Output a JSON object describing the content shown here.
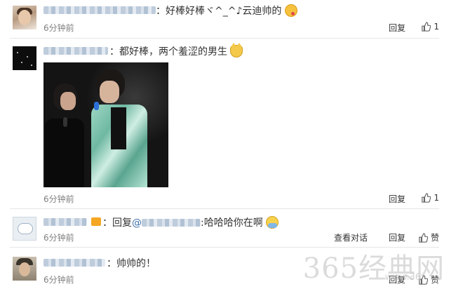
{
  "comments": [
    {
      "text_a": "：好棒好棒ヾ^_^♪云迪帅的",
      "emoji": "kiss-emoji",
      "time": "6分钟前",
      "reply": "回复",
      "likes": "1"
    },
    {
      "text_a": "：都好棒，两个羞涩的男生",
      "emoji": "cat-emoji",
      "time": "6分钟前",
      "reply": "回复",
      "likes": "1"
    },
    {
      "text_a": "：回复",
      "mention": "@",
      "text_b": ":哈哈哈你在啊",
      "emoji": "hand-emoji",
      "time": "6分钟前",
      "view_thread": "查看对话",
      "reply": "回复",
      "likes": "赞"
    },
    {
      "text_a": "：帅帅的！",
      "time": "6分钟前",
      "reply": "回复",
      "likes": "赞"
    }
  ],
  "watermark": {
    "main": "365经典网",
    "sub": "www.36"
  },
  "icons": {
    "like": "thumbs-up-icon"
  }
}
